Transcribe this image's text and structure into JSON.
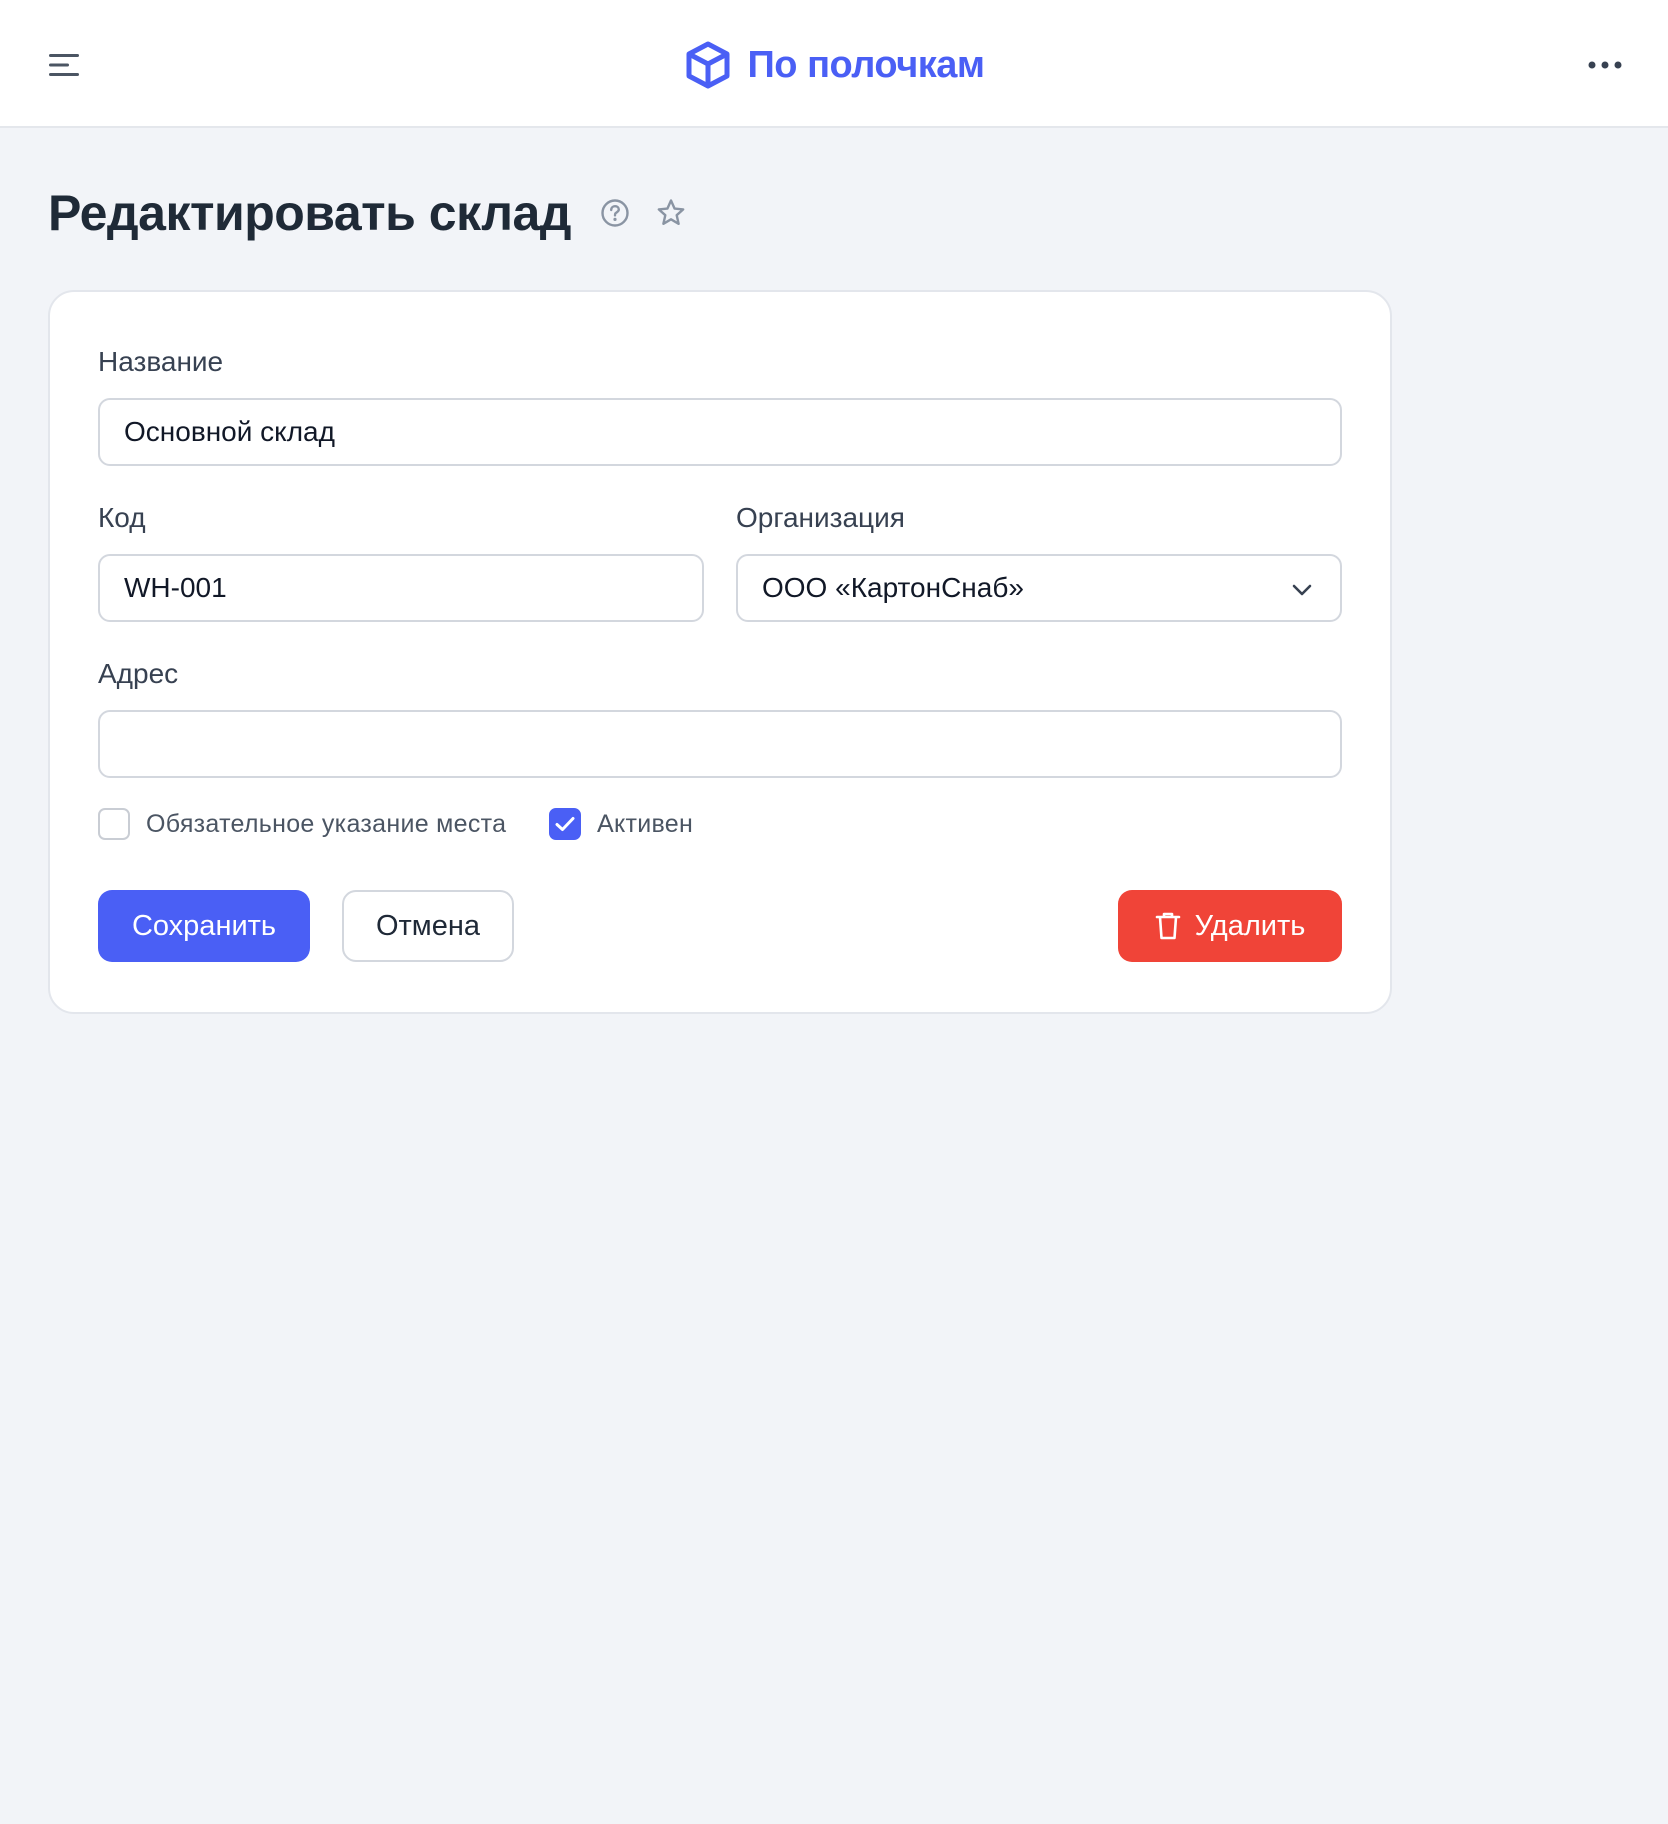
{
  "header": {
    "brand_name": "По полочкам",
    "brand_color": "#4a5ff5",
    "menu_icon": "hamburger-menu-icon",
    "more_icon": "more-horizontal-icon"
  },
  "page": {
    "title": "Редактировать склад",
    "help_icon": "help-circle-icon",
    "favorite_icon": "star-outline-icon"
  },
  "form": {
    "name": {
      "label": "Название",
      "value": "Основной склад"
    },
    "code": {
      "label": "Код",
      "value": "WH-001"
    },
    "organization": {
      "label": "Организация",
      "selected": "ООО «КартонСнаб»"
    },
    "address": {
      "label": "Адрес",
      "value": ""
    },
    "checkboxes": [
      {
        "label": "Обязательное указание места",
        "checked": false
      },
      {
        "label": "Активен",
        "checked": true
      }
    ]
  },
  "actions": {
    "save_label": "Сохранить",
    "cancel_label": "Отмена",
    "delete_label": "Удалить",
    "primary_color": "#4a5ff5",
    "danger_color": "#f04438"
  }
}
